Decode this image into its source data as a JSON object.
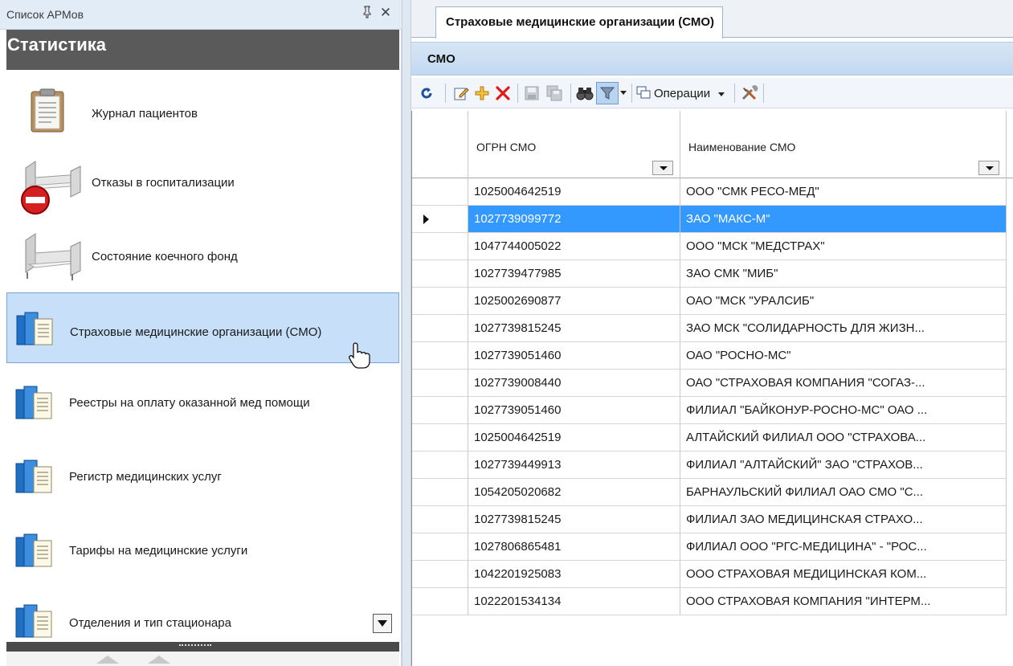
{
  "left_panel": {
    "title": "Список АРМов",
    "pin_glyph": "ᵽ",
    "close_glyph": "✕",
    "group_title": "Статистика",
    "items": [
      {
        "label": "Журнал пациентов",
        "icon": "clipboard-icon"
      },
      {
        "label": "Отказы в госпитализации",
        "icon": "bed-denied-icon"
      },
      {
        "label": "Состояние коечного фонд",
        "icon": "bed-icon"
      },
      {
        "label": "Страховые медицинские организации (СМО)",
        "icon": "document-stack-icon",
        "selected": true
      },
      {
        "label": "Реестры на оплату оказанной мед помощи",
        "icon": "document-stack-icon"
      },
      {
        "label": "Регистр медицинских услуг",
        "icon": "document-stack-icon"
      },
      {
        "label": "Тарифы на медицинские услуги",
        "icon": "document-stack-icon"
      },
      {
        "label": "Отделения и тип стационара",
        "icon": "document-stack-icon"
      }
    ]
  },
  "right_panel": {
    "tab_label": "Страховые медицинские организации (СМО)",
    "section_title": "СМО",
    "toolbar": {
      "refresh": "refresh-icon",
      "edit": "edit-icon",
      "add": "add-icon",
      "delete": "delete-icon",
      "save": "save-icon",
      "save_all": "save-all-icon",
      "find": "binoculars-icon",
      "filter": "filter-icon",
      "operations_label": "Операции",
      "settings": "tools-icon"
    },
    "grid": {
      "columns": [
        "ОГРН СМО",
        "Наименование СМО"
      ],
      "selected_row": 1,
      "rows": [
        {
          "ogrn": "1025004642519",
          "name": "ООО \"СМК РЕСО-МЕД\""
        },
        {
          "ogrn": "1027739099772",
          "name": "ЗАО \"МАКС-М\""
        },
        {
          "ogrn": "1047744005022",
          "name": "ООО \"МСК \"МЕДСТРАХ\""
        },
        {
          "ogrn": "1027739477985",
          "name": "ЗАО СМК \"МИБ\""
        },
        {
          "ogrn": "1025002690877",
          "name": "ОАО \"МСК \"УРАЛСИБ\""
        },
        {
          "ogrn": "1027739815245",
          "name": "ЗАО МСК \"СОЛИДАРНОСТЬ ДЛЯ ЖИЗН..."
        },
        {
          "ogrn": "1027739051460",
          "name": "ОАО \"РОСНО-МС\""
        },
        {
          "ogrn": "1027739008440",
          "name": "ОАО \"СТРАХОВАЯ КОМПАНИЯ \"СОГАЗ-..."
        },
        {
          "ogrn": "1027739051460",
          "name": "ФИЛИАЛ \"БАЙКОНУР-РОСНО-МС\" ОАО ..."
        },
        {
          "ogrn": "1025004642519",
          "name": "АЛТАЙСКИЙ ФИЛИАЛ ООО \"СТРАХОВА..."
        },
        {
          "ogrn": "1027739449913",
          "name": "ФИЛИАЛ \"АЛТАЙСКИЙ\" ЗАО \"СТРАХОВ..."
        },
        {
          "ogrn": "1054205020682",
          "name": "БАРНАУЛЬСКИЙ ФИЛИАЛ ОАО СМО \"С..."
        },
        {
          "ogrn": "1027739815245",
          "name": "ФИЛИАЛ ЗАО МЕДИЦИНСКАЯ СТРАХО..."
        },
        {
          "ogrn": "1027806865481",
          "name": "ФИЛИАЛ ООО \"РГС-МЕДИЦИНА\" - \"РОС..."
        },
        {
          "ogrn": "1042201925083",
          "name": "ООО СТРАХОВАЯ МЕДИЦИНСКАЯ КОМ..."
        },
        {
          "ogrn": "1022201534134",
          "name": "ООО СТРАХОВАЯ КОМПАНИЯ \"ИНТЕРМ..."
        }
      ]
    }
  }
}
